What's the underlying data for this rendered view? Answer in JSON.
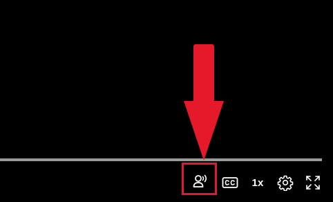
{
  "player": {
    "controls": {
      "speed_label": "1x"
    },
    "icons": {
      "audio_description": "audio-description-icon",
      "captions": "closed-captions-icon",
      "settings": "gear-icon",
      "fullscreen": "fullscreen-icon"
    }
  },
  "annotation": {
    "color": "#e6192b",
    "target": "audio-description-button"
  }
}
